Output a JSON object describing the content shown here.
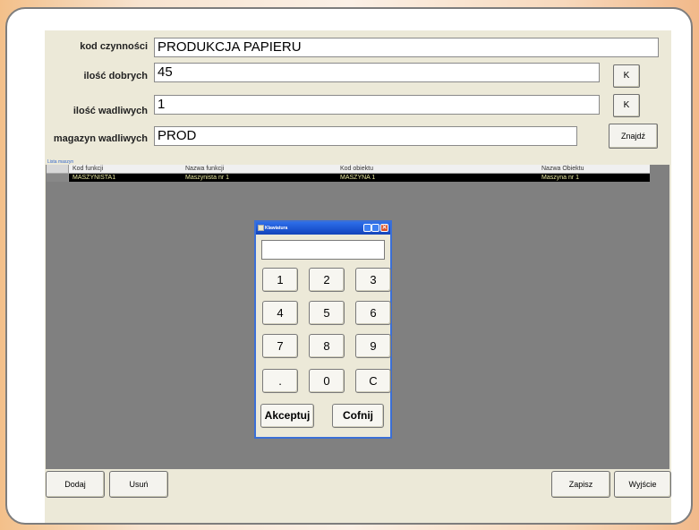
{
  "form": {
    "activity_code_label": "kod czynności",
    "activity_code_value": "PRODUKCJA PAPIERU",
    "good_qty_label": "ilość dobrych",
    "good_qty_value": "45",
    "defect_qty_label": "ilość wadliwych",
    "defect_qty_value": "1",
    "defect_store_label": "magazyn wadliwych",
    "defect_store_value": "PROD",
    "k_button": "K",
    "find_button": "Znajdź"
  },
  "grid": {
    "caption": "Lista maszyn",
    "columns": [
      "Kod funkcji",
      "Nazwa funkcji",
      "Kod obiektu",
      "Nazwa Obiektu"
    ],
    "rows": [
      [
        "MASZYNISTA1",
        "Maszynista nr 1",
        "MASZYNA 1",
        "Maszyna nr 1"
      ]
    ]
  },
  "dialog": {
    "title": "Klawiatura",
    "keys": [
      "1",
      "2",
      "3",
      "4",
      "5",
      "6",
      "7",
      "8",
      "9",
      ".",
      "0",
      "C"
    ],
    "accept": "Akceptuj",
    "cancel": "Cofnij"
  },
  "bottom": {
    "add": "Dodaj",
    "remove": "Usuń",
    "save": "Zapisz",
    "exit": "Wyjście"
  }
}
